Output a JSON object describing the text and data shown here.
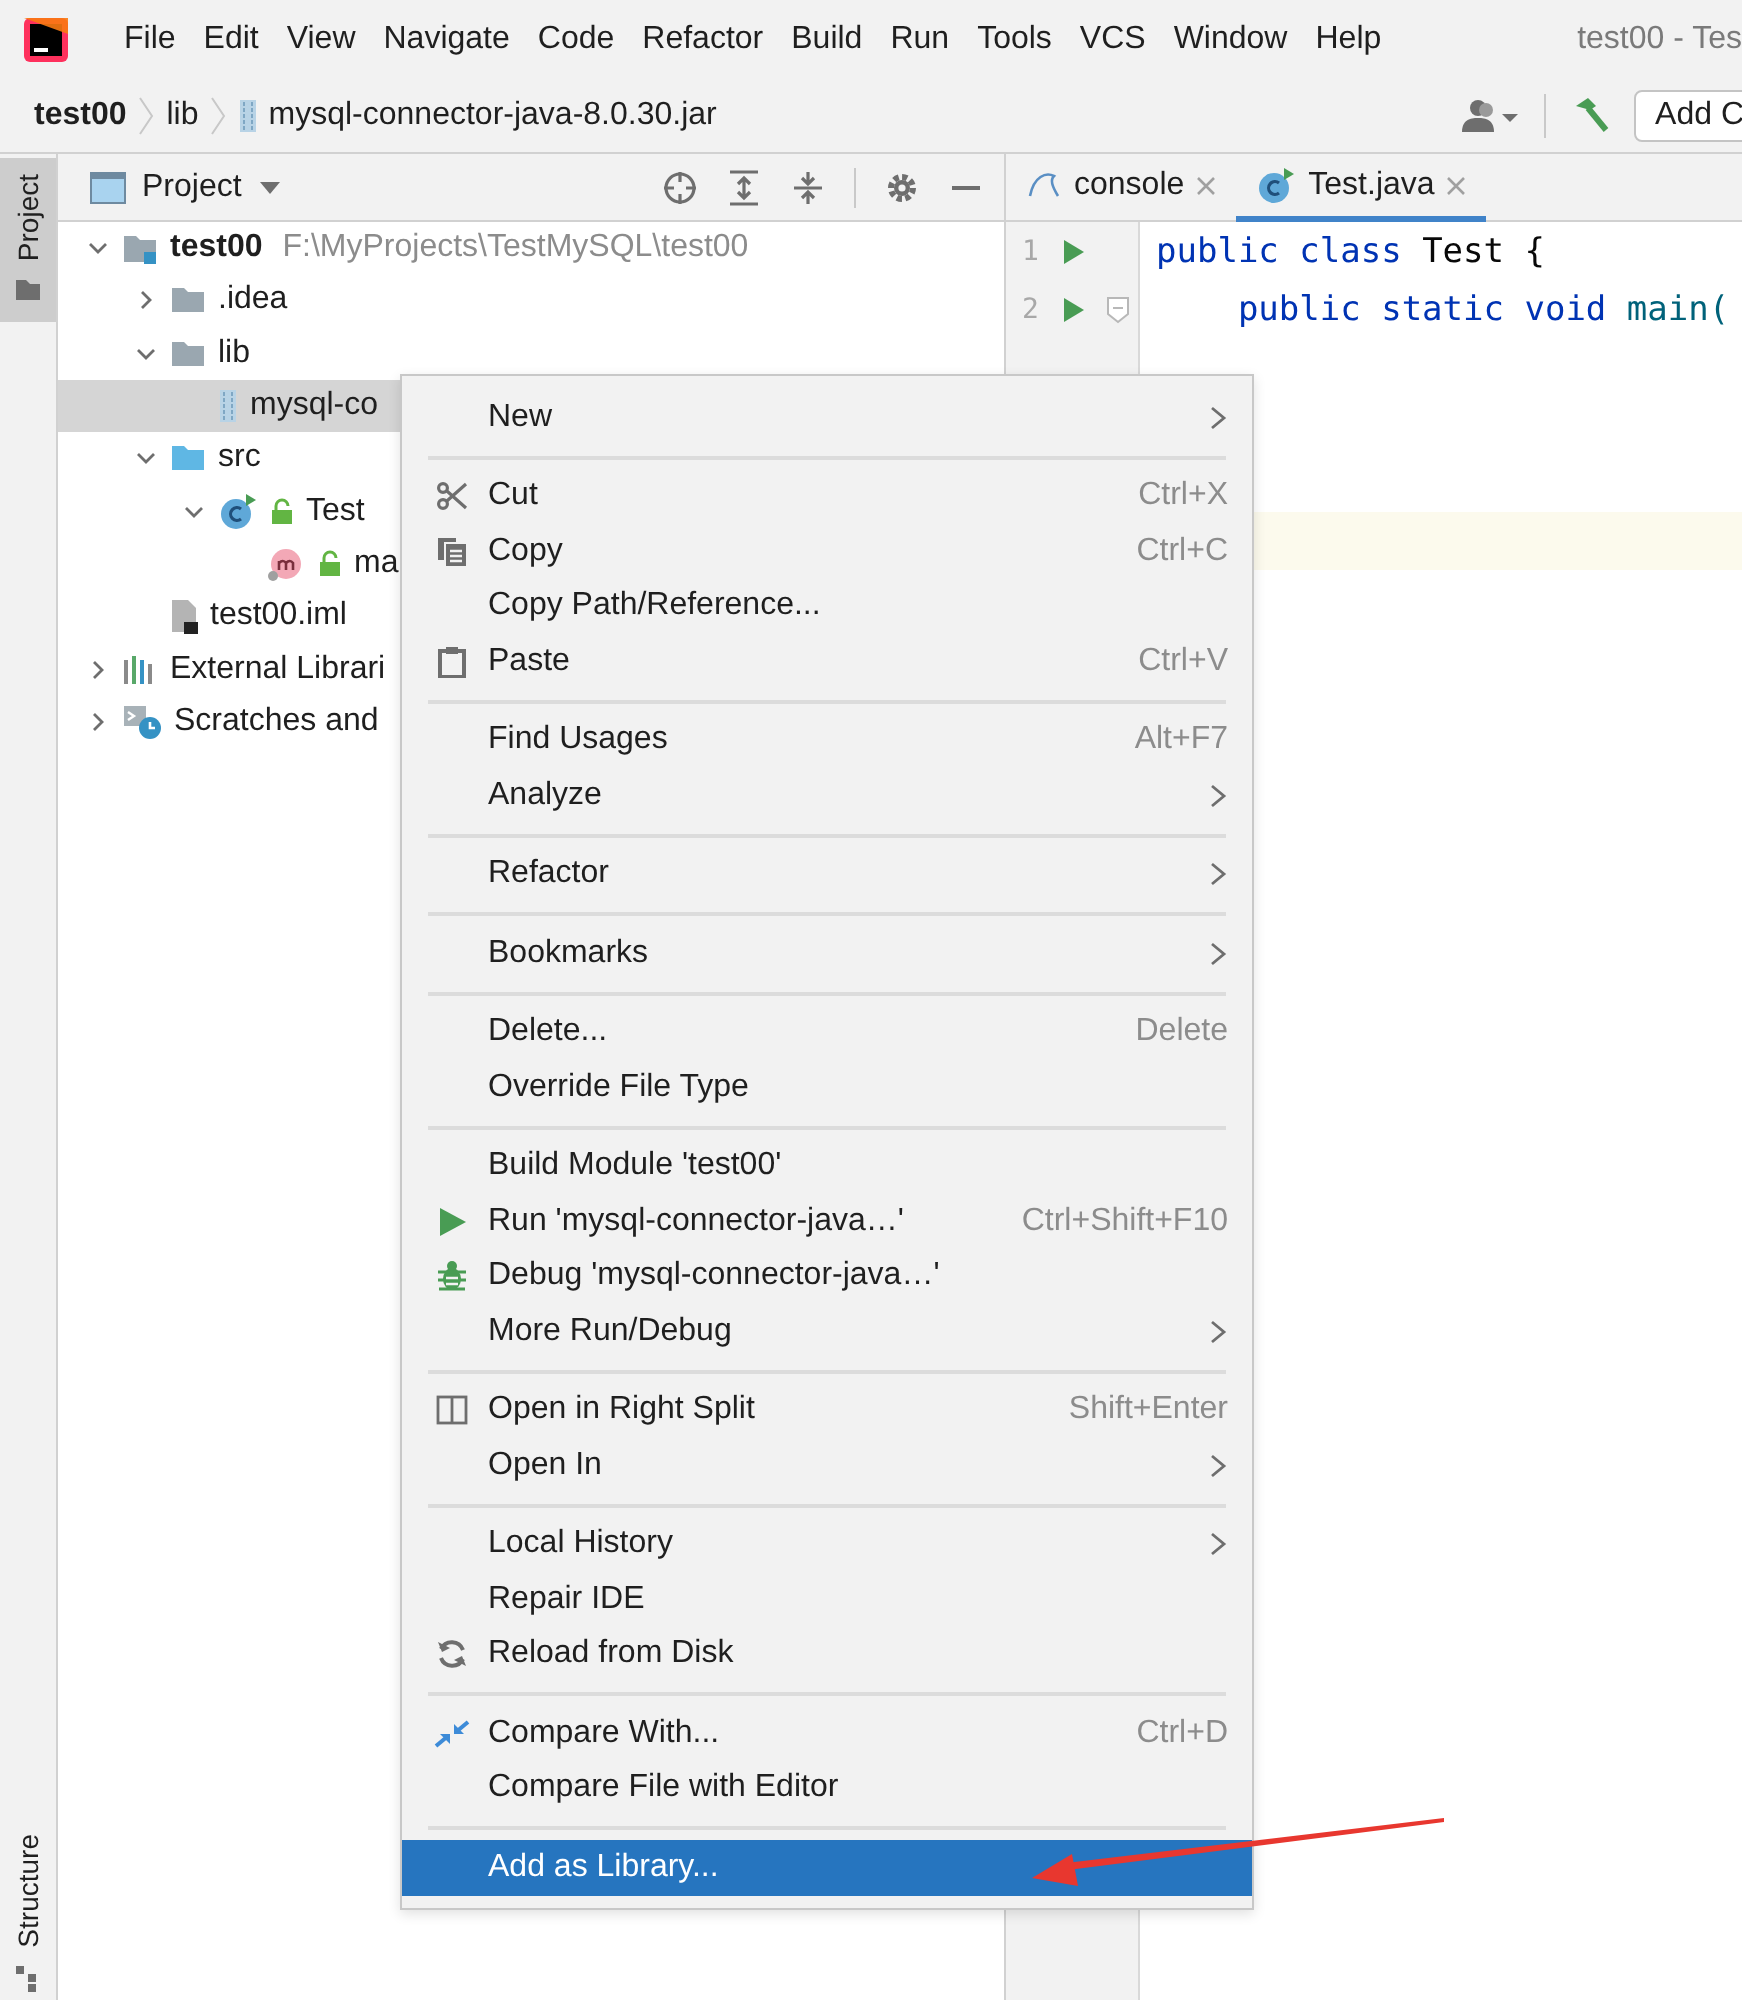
{
  "title_bar": {
    "menu": [
      "File",
      "Edit",
      "View",
      "Navigate",
      "Code",
      "Refactor",
      "Build",
      "Run",
      "Tools",
      "VCS",
      "Window",
      "Help"
    ],
    "title": "test00 - Tes"
  },
  "navigation_bar": {
    "breadcrumbs": [
      {
        "label": "test00",
        "kind": "project"
      },
      {
        "label": "lib",
        "kind": "folder"
      },
      {
        "label": "mysql-connector-java-8.0.30.jar",
        "kind": "jar"
      }
    ],
    "run_config_button": "Add C"
  },
  "tool_window_tabs": [
    {
      "label": "Project",
      "selected": true
    },
    {
      "label": "Structure",
      "selected": false
    }
  ],
  "project_panel": {
    "title": "Project",
    "tree": [
      {
        "label": "test00",
        "kind": "module",
        "path": "F:\\MyProjects\\TestMySQL\\test00",
        "expanded": true,
        "selected": false,
        "children": [
          {
            "label": ".idea",
            "kind": "folder",
            "expanded": false,
            "selected": false
          },
          {
            "label": "lib",
            "kind": "folder",
            "expanded": true,
            "selected": false,
            "children": [
              {
                "label": "mysql-co",
                "kind": "jar",
                "selected": true
              }
            ]
          },
          {
            "label": "src",
            "kind": "source_folder",
            "expanded": true,
            "selected": false,
            "children": [
              {
                "label": "Test",
                "kind": "class",
                "expanded": true,
                "selected": false,
                "children": [
                  {
                    "label": "ma",
                    "kind": "method",
                    "selected": false
                  }
                ]
              }
            ]
          },
          {
            "label": "test00.iml",
            "kind": "iml",
            "selected": false
          }
        ]
      },
      {
        "label": "External Librari",
        "kind": "libraries",
        "expanded": false,
        "selected": false
      },
      {
        "label": "Scratches and",
        "kind": "scratches",
        "expanded": false,
        "selected": false
      }
    ]
  },
  "editor": {
    "tabs": [
      {
        "label": "console",
        "kind": "console",
        "selected": false
      },
      {
        "label": "Test.java",
        "kind": "class",
        "selected": true
      }
    ],
    "lines": [
      {
        "number": "1",
        "run": true,
        "fold": false,
        "tokens": [
          {
            "text": "public class",
            "kind": "keyword"
          },
          {
            "text": " Test {",
            "kind": "plain"
          }
        ]
      },
      {
        "number": "2",
        "run": true,
        "fold": true,
        "tokens": [
          {
            "text": "    public static void",
            "kind": "keyword"
          },
          {
            "text": " main(",
            "kind": "function"
          }
        ]
      }
    ],
    "caret_line_highlight": true
  },
  "context_menu": {
    "items": [
      {
        "kind": "item",
        "label": "New",
        "submenu": true,
        "selected": false
      },
      {
        "kind": "separator"
      },
      {
        "kind": "item",
        "label": "Cut",
        "shortcut": "Ctrl+X",
        "selected": false
      },
      {
        "kind": "item",
        "label": "Copy",
        "shortcut": "Ctrl+C",
        "selected": false
      },
      {
        "kind": "item",
        "label": "Copy Path/Reference...",
        "selected": false
      },
      {
        "kind": "item",
        "label": "Paste",
        "shortcut": "Ctrl+V",
        "selected": false
      },
      {
        "kind": "separator"
      },
      {
        "kind": "item",
        "label": "Find Usages",
        "shortcut": "Alt+F7",
        "selected": false
      },
      {
        "kind": "item",
        "label": "Analyze",
        "submenu": true,
        "selected": false
      },
      {
        "kind": "separator"
      },
      {
        "kind": "item",
        "label": "Refactor",
        "submenu": true,
        "selected": false
      },
      {
        "kind": "separator"
      },
      {
        "kind": "item",
        "label": "Bookmarks",
        "submenu": true,
        "selected": false
      },
      {
        "kind": "separator"
      },
      {
        "kind": "item",
        "label": "Delete...",
        "shortcut": "Delete",
        "selected": false
      },
      {
        "kind": "item",
        "label": "Override File Type",
        "selected": false
      },
      {
        "kind": "separator"
      },
      {
        "kind": "item",
        "label": "Build Module 'test00'",
        "selected": false
      },
      {
        "kind": "item",
        "label": "Run 'mysql-connector-java…'",
        "shortcut": "Ctrl+Shift+F10",
        "selected": false
      },
      {
        "kind": "item",
        "label": "Debug 'mysql-connector-java…'",
        "selected": false
      },
      {
        "kind": "item",
        "label": "More Run/Debug",
        "submenu": true,
        "selected": false
      },
      {
        "kind": "separator"
      },
      {
        "kind": "item",
        "label": "Open in Right Split",
        "shortcut": "Shift+Enter",
        "selected": false
      },
      {
        "kind": "item",
        "label": "Open In",
        "submenu": true,
        "selected": false
      },
      {
        "kind": "separator"
      },
      {
        "kind": "item",
        "label": "Local History",
        "submenu": true,
        "selected": false
      },
      {
        "kind": "item",
        "label": "Repair IDE",
        "selected": false
      },
      {
        "kind": "item",
        "label": "Reload from Disk",
        "selected": false
      },
      {
        "kind": "separator"
      },
      {
        "kind": "item",
        "label": "Compare With...",
        "shortcut": "Ctrl+D",
        "selected": false
      },
      {
        "kind": "item",
        "label": "Compare File with Editor",
        "selected": false
      },
      {
        "kind": "separator"
      },
      {
        "kind": "item",
        "label": "Add as Library...",
        "selected": true
      }
    ]
  }
}
